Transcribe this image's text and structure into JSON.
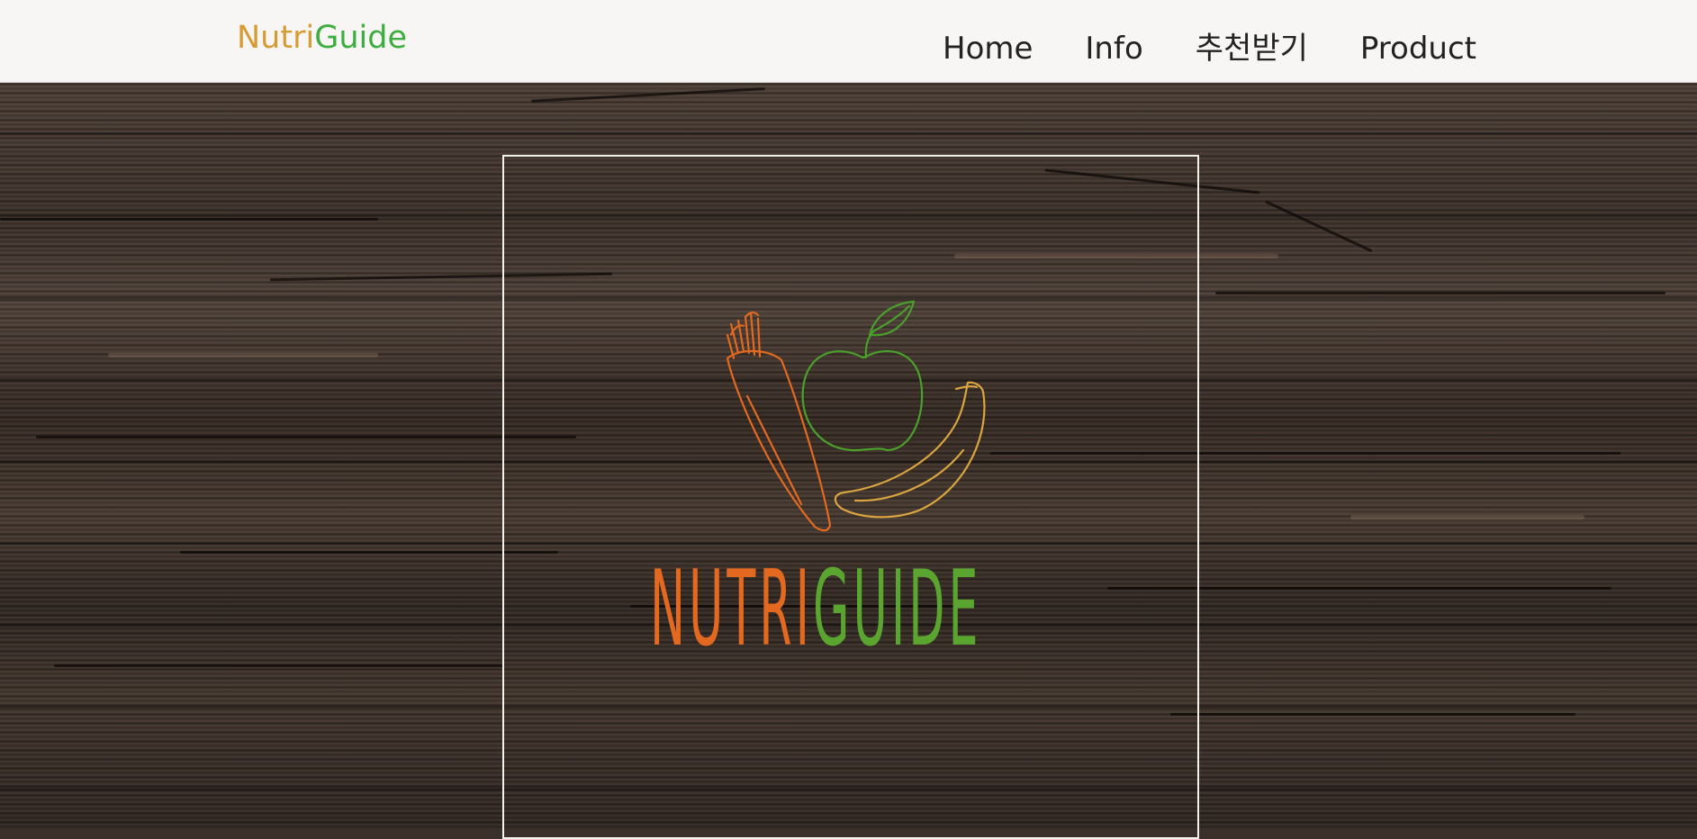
{
  "header": {
    "brand": {
      "part1": "Nutri",
      "part2": "Guide"
    },
    "nav": [
      {
        "label": "Home",
        "active": true
      },
      {
        "label": "Info",
        "active": false
      },
      {
        "label": "추천받기",
        "active": false
      },
      {
        "label": "Product",
        "active": false
      }
    ]
  },
  "hero": {
    "logo_text_part1": "NUTRI",
    "logo_text_part2": "GUIDE",
    "logo_icons": [
      "carrot-icon",
      "apple-icon",
      "banana-icon"
    ]
  },
  "colors": {
    "brand_orange": "#d59c35",
    "brand_green": "#3cad3e",
    "logo_orange": "#e2691f",
    "logo_green": "#5aa530",
    "logo_yellow": "#d9a540",
    "header_bg": "#f7f6f4"
  }
}
